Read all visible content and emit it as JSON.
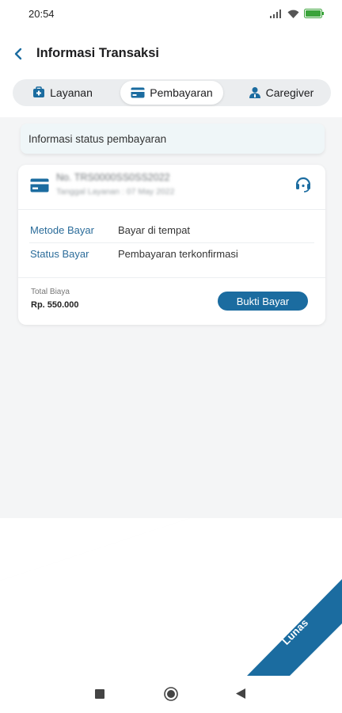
{
  "status_bar": {
    "time": "20:54",
    "icons": [
      "signal-icon",
      "wifi-icon",
      "battery-icon"
    ]
  },
  "header": {
    "title": "Informasi Transaksi",
    "back_icon": "chevron-left-icon"
  },
  "tabs": [
    {
      "label": "Layanan",
      "icon": "medical-bag-icon",
      "active": false
    },
    {
      "label": "Pembayaran",
      "icon": "credit-card-icon",
      "active": true
    },
    {
      "label": "Caregiver",
      "icon": "person-icon",
      "active": false
    }
  ],
  "info_bar": {
    "text": "Informasi status pembayaran"
  },
  "transaction": {
    "number": "No. TRS0000SS0SS2022",
    "date": "Tanggal Layanan : 07 May 2022",
    "rows": [
      {
        "label": "Metode Bayar",
        "value": "Bayar di tempat"
      },
      {
        "label": "Status Bayar",
        "value": "Pembayaran terkonfirmasi"
      }
    ],
    "total_label": "Total Biaya",
    "total_value": "Rp. 550.000",
    "proof_button": "Bukti Bayar"
  },
  "ribbon": {
    "text": "Lunas"
  },
  "colors": {
    "accent": "#1b6ca0",
    "label_blue": "#2b6c9a",
    "background": "#f4f5f6"
  },
  "nav": {
    "icons": [
      "recents-square-icon",
      "home-circle-icon",
      "back-triangle-icon"
    ]
  }
}
